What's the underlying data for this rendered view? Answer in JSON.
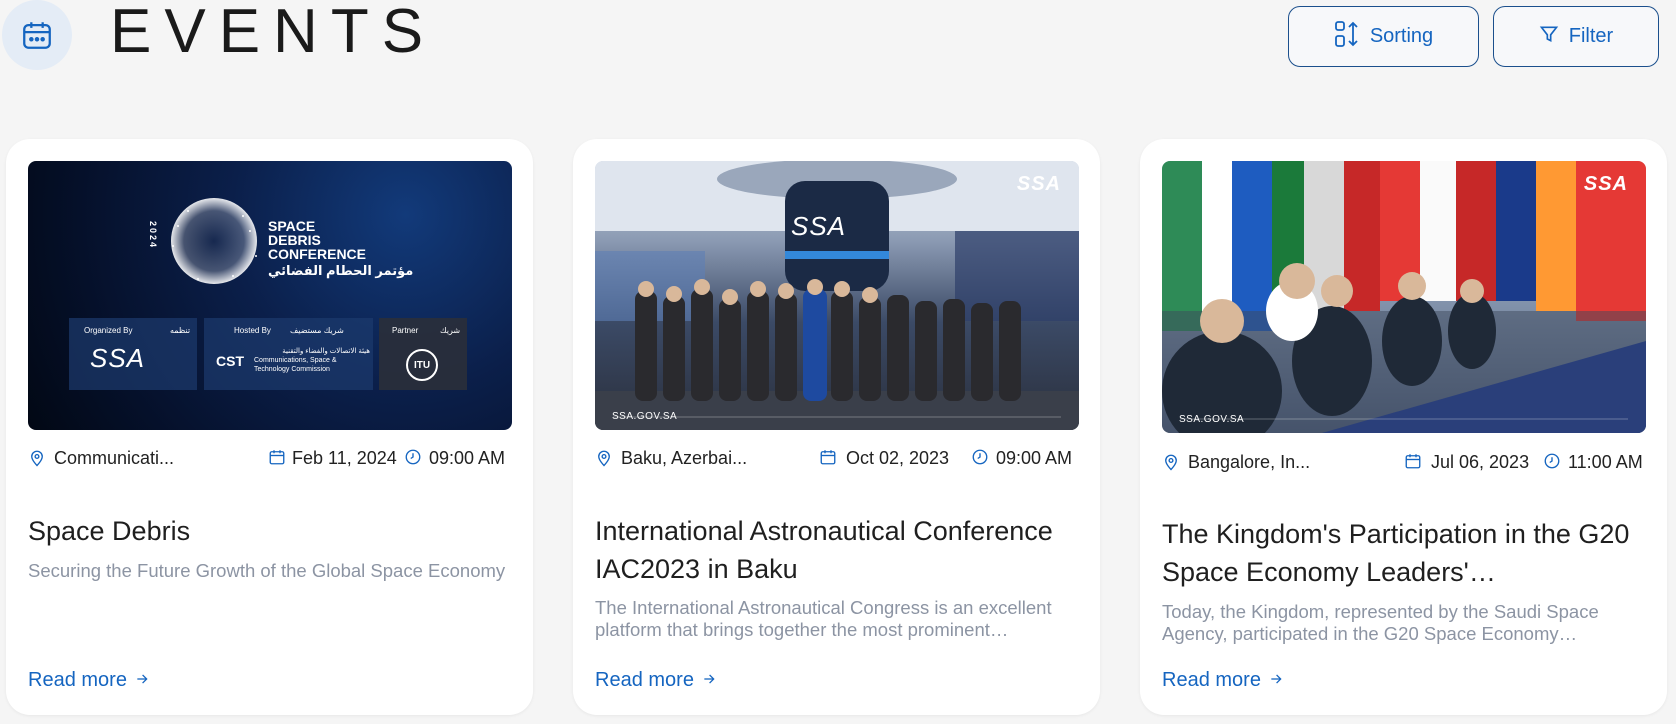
{
  "header": {
    "title": "EVENTS",
    "sort_label": "Sorting",
    "filter_label": "Filter"
  },
  "cards": [
    {
      "location": "Communicati...",
      "date": "Feb 11, 2024",
      "time": "09:00 AM",
      "title": "Space Debris",
      "description": "Securing the Future Growth of the Global Space Economy",
      "read_more": "Read more",
      "poster": {
        "year": "2024",
        "heading_lines": [
          "SPACE",
          "DEBRIS",
          "CONFERENCE"
        ],
        "heading_ar": "مؤتمر الحطام الفضائي",
        "organized_by": "Organized By",
        "organized_by_ar": "تنظمه",
        "hosted_by": "Hosted By",
        "hosted_by_ar": "شريك مستضيف",
        "partner": "Partner",
        "partner_ar": "شريك",
        "cst_ar": "هيئة الاتصالات والفضاء والتقنية",
        "cst_en": "Communications, Space & Technology Commission",
        "cst_logo": "CST",
        "itu_logo": "ITU",
        "ssa_logo": "SSA"
      }
    },
    {
      "location": "Baku, Azerbai...",
      "date": "Oct 02, 2023",
      "time": "09:00 AM",
      "title": "International Astronautical Conference IAC2023 in Baku",
      "description": "The International Astronautical Congress is an excellent platform that brings together the most prominent…",
      "read_more": "Read more",
      "watermark": "SSA.GOV.SA",
      "badge": "SSA",
      "tower_logo": "SSA"
    },
    {
      "location": "Bangalore, In...",
      "date": "Jul 06, 2023",
      "time": "11:00 AM",
      "title": "The Kingdom's Participation in the G20 Space Economy Leaders'…",
      "description": "Today, the Kingdom, represented by the Saudi Space Agency, participated in the G20 Space Economy…",
      "read_more": "Read more",
      "watermark": "SSA.GOV.SA",
      "badge": "SSA"
    }
  ],
  "colors": {
    "accent": "#1565c0",
    "muted": "#8c94a3",
    "background": "#f5f5f5"
  }
}
